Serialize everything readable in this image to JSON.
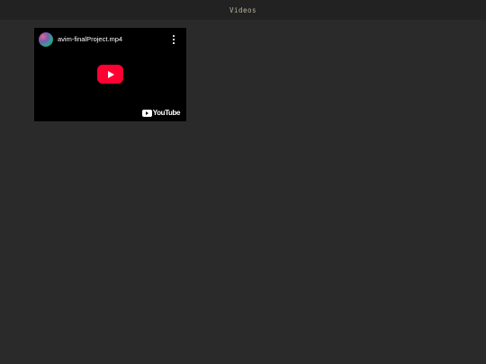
{
  "header": {
    "title": "Videos"
  },
  "video": {
    "title": "avim-finalProject.mp4",
    "channel_avatar_icon": "channel-avatar",
    "menu_icon": "more-vertical-icon",
    "play_icon": "youtube-play-icon",
    "brand_logo_text": "YouTube"
  },
  "colors": {
    "page_background": "#2a2a2a",
    "header_background": "#222222",
    "header_text": "#b9b59c",
    "video_background": "#000000",
    "play_button": "#ff0033"
  }
}
